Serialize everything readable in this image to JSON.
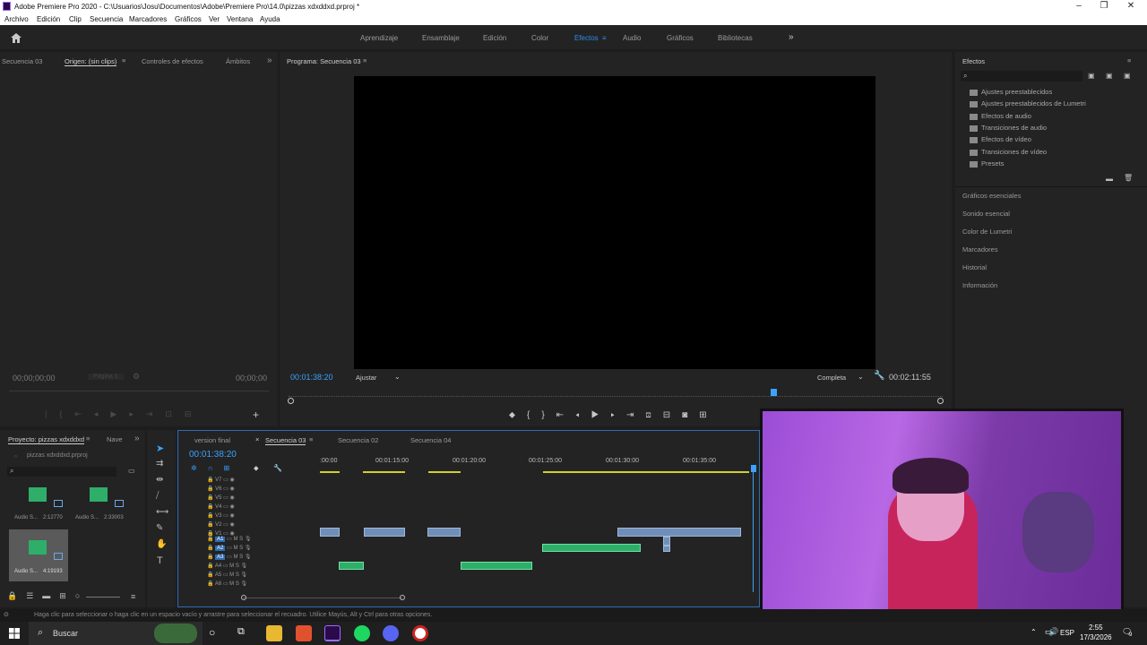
{
  "window": {
    "title": "Adobe Premiere Pro 2020 - C:\\Usuarios\\Josu\\Documentos\\Adobe\\Premiere Pro\\14.0\\pizzas xdxddxd.prproj *",
    "minimize": "–",
    "maximize": "❐",
    "close": "✕"
  },
  "menu": [
    "Archivo",
    "Edición",
    "Clip",
    "Secuencia",
    "Marcadores",
    "Gráficos",
    "Ver",
    "Ventana",
    "Ayuda"
  ],
  "workspaces": {
    "items": [
      "Aprendizaje",
      "Ensamblaje",
      "Edición",
      "Color",
      "Efectos",
      "Audio",
      "Gráficos",
      "Bibliotecas"
    ],
    "active": "Efectos",
    "more": "»"
  },
  "source_panel": {
    "tabs": [
      "Secuencia 03",
      "Origen: (sin clips)",
      "Controles de efectos",
      "Ámbitos"
    ],
    "more": "»",
    "tc_left": "00;00;00;00",
    "page": "Página 1",
    "tc_right": "00;00;00"
  },
  "program_panel": {
    "title": "Programa: Secuencia 03",
    "timecode": "00:01:38:20",
    "fit": "Ajustar",
    "quality": "Completa",
    "duration": "00:02:11:55"
  },
  "effects_panel": {
    "title": "Efectos",
    "items": [
      "Ajustes preestablecidos",
      "Ajustes preestablecidos de Lumetri",
      "Efectos de audio",
      "Transiciones de audio",
      "Efectos de vídeo",
      "Transiciones de vídeo",
      "Presets"
    ],
    "sections": [
      "Gráficos esenciales",
      "Sonido esencial",
      "Color de Lumetri",
      "Marcadores",
      "Historial",
      "Información"
    ]
  },
  "project_panel": {
    "tab": "Proyecto: pizzas xdxddxd",
    "tab2": "Nave",
    "more": "»",
    "file": "pizzas xdxddxd.prproj",
    "clips": [
      {
        "name": "Audio S...",
        "dur": "2:12770"
      },
      {
        "name": "Audio S...",
        "dur": "2:33003"
      },
      {
        "name": "Audio S...",
        "dur": "4:19193"
      }
    ]
  },
  "timeline": {
    "tabs": [
      "version final",
      "Secuencia 03",
      "Secuencia 02",
      "Secuencia 04"
    ],
    "active": "Secuencia 03",
    "timecode": "00:01:38:20",
    "ruler": [
      ":00:00",
      "00:01:15:00",
      "00:01:20:00",
      "00:01:25:00",
      "00:01:30:00",
      "00:01:35:00"
    ],
    "video_tracks": [
      "V7",
      "V6",
      "V5",
      "V4",
      "V3",
      "V2",
      "V1"
    ],
    "audio_tracks": [
      "A1",
      "A2",
      "A3",
      "A4",
      "A5",
      "A6"
    ]
  },
  "status": "Haga clic para seleccionar o haga clic en un espacio vacío y arrastre para seleccionar el recuadro. Utilice Mayús, Alt y Ctrl para otras opciones.",
  "taskbar": {
    "search": "Buscar",
    "lang": "ESP",
    "time": "2:55",
    "date": "17/3/2026",
    "notif": "9"
  },
  "colors": {
    "accent": "#2d8ceb",
    "timecode": "#3ba2ff",
    "audio_clip": "#2fae6a",
    "video_clip": "#6f8fb8",
    "webcam_bg": "#a24fd6"
  }
}
